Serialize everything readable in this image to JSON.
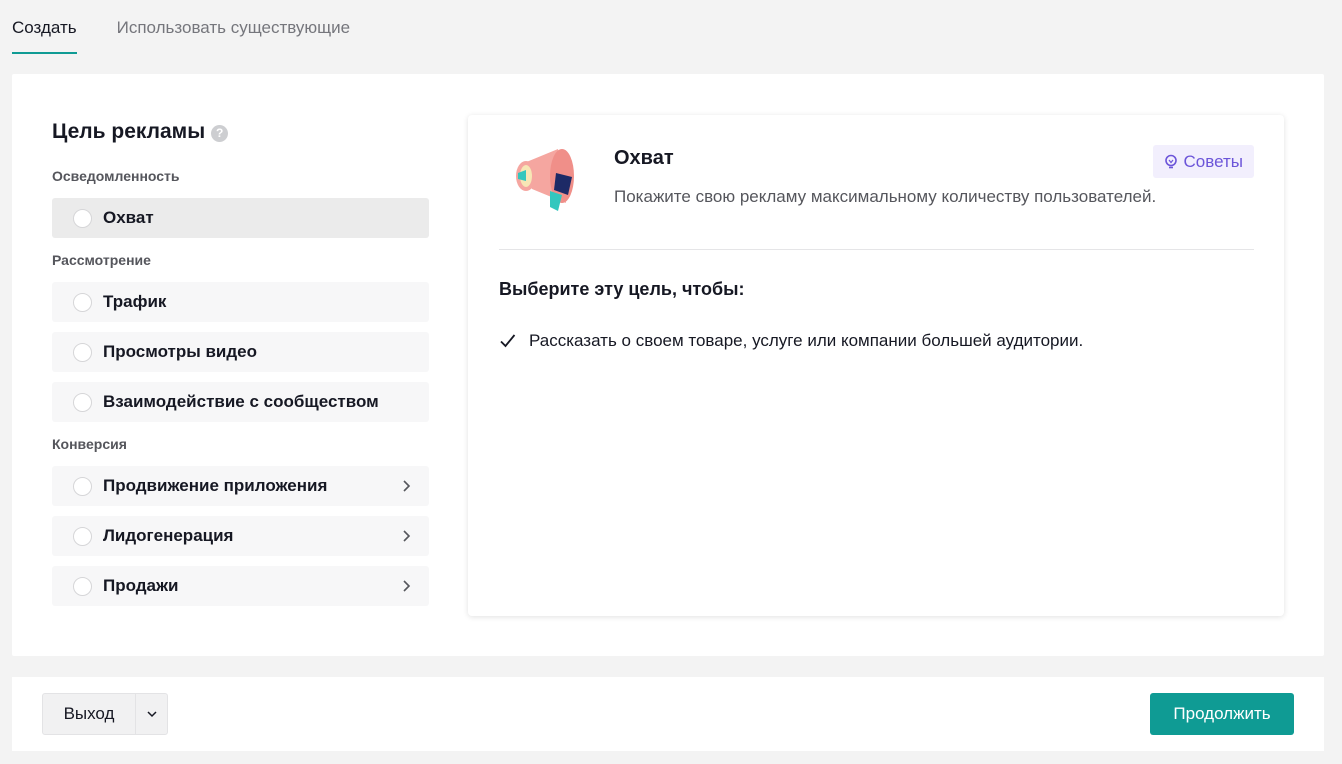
{
  "tabs": [
    {
      "label": "Создать",
      "active": true
    },
    {
      "label": "Использовать существующие",
      "active": false
    }
  ],
  "objective": {
    "title": "Цель рекламы",
    "help_icon": "?",
    "groups": [
      {
        "label": "Осведомленность",
        "options": [
          {
            "label": "Охват",
            "selected": true,
            "has_submenu": false
          }
        ]
      },
      {
        "label": "Рассмотрение",
        "options": [
          {
            "label": "Трафик",
            "selected": false,
            "has_submenu": false
          },
          {
            "label": "Просмотры видео",
            "selected": false,
            "has_submenu": false
          },
          {
            "label": "Взаимодействие с сообществом",
            "selected": false,
            "has_submenu": false
          }
        ]
      },
      {
        "label": "Конверсия",
        "options": [
          {
            "label": "Продвижение приложения",
            "selected": false,
            "has_submenu": true
          },
          {
            "label": "Лидогенерация",
            "selected": false,
            "has_submenu": true
          },
          {
            "label": "Продажи",
            "selected": false,
            "has_submenu": true
          }
        ]
      }
    ]
  },
  "detail": {
    "icon": "megaphone-icon",
    "title": "Охват",
    "description": "Покажите свою рекламу максимальному количеству пользователей.",
    "tips_label": "Советы",
    "why_title": "Выберите эту цель, чтобы:",
    "reasons": [
      "Рассказать о своем товаре, услуге или компании большей аудитории."
    ]
  },
  "footer": {
    "exit_label": "Выход",
    "continue_label": "Продолжить"
  },
  "colors": {
    "accent": "#0f9b94",
    "tips": "#6c55d9",
    "tips_bg": "#f2effd"
  }
}
